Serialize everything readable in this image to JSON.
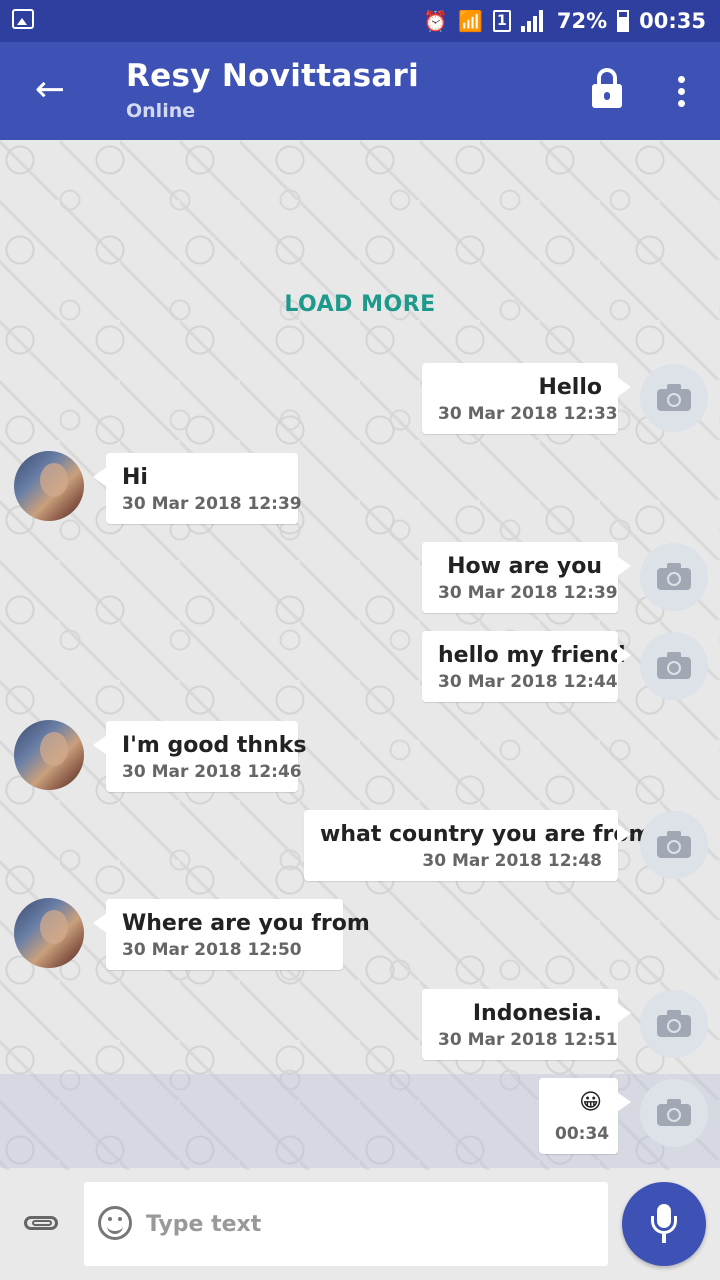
{
  "status_bar": {
    "battery": "72%",
    "time": "00:35",
    "sim_label": "1",
    "icons": [
      "image-notification-icon",
      "alarm-icon",
      "wifi-icon",
      "signal-icon",
      "battery-icon"
    ]
  },
  "header": {
    "contact_name": "Resy Novittasari",
    "contact_status": "Online",
    "icons": [
      "back-arrow-icon",
      "lock-icon",
      "more-vert-icon"
    ]
  },
  "chat": {
    "load_more": "LOAD MORE",
    "messages": [
      {
        "direction": "out",
        "text": "Hello",
        "time": "30 Mar 2018 12:33"
      },
      {
        "direction": "in",
        "text": "Hi",
        "time": "30 Mar 2018 12:39"
      },
      {
        "direction": "out",
        "text": "How are you",
        "time": "30 Mar 2018 12:39"
      },
      {
        "direction": "out",
        "text": "hello my friend",
        "time": "30 Mar 2018 12:44"
      },
      {
        "direction": "in",
        "text": "I'm good thnks",
        "time": "30 Mar 2018 12:46"
      },
      {
        "direction": "out",
        "text": "what country you are from",
        "time": "30 Mar 2018 12:48"
      },
      {
        "direction": "in",
        "text": "Where are you from",
        "time": "30 Mar 2018 12:50"
      },
      {
        "direction": "out",
        "text": "Indonesia.",
        "time": "30 Mar 2018 12:51"
      },
      {
        "direction": "out",
        "text": "😀",
        "time": "00:34"
      }
    ]
  },
  "input": {
    "placeholder": "Type text",
    "icons": [
      "attach-icon",
      "emoji-icon",
      "mic-icon"
    ]
  },
  "colors": {
    "status_bar": "#2f3f9f",
    "app_bar": "#3e51b5",
    "load_more": "#1d9a8c",
    "mic_button": "#3e51b5"
  }
}
